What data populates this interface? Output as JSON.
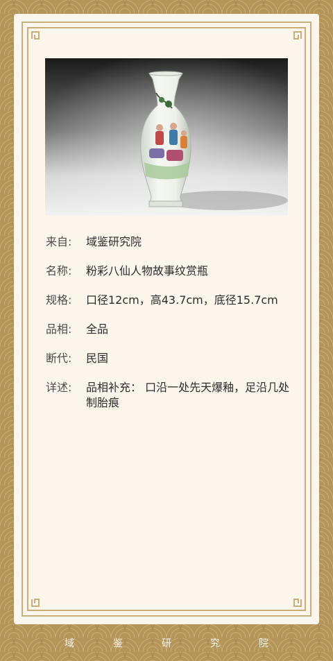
{
  "details": [
    {
      "label": "来自:",
      "value": "域鉴研究院"
    },
    {
      "label": "名称:",
      "value": "粉彩八仙人物故事纹赏瓶"
    },
    {
      "label": "规格:",
      "value": "口径12cm，高43.7cm，底径15.7cm"
    },
    {
      "label": "品相:",
      "value": "全品"
    },
    {
      "label": "断代:",
      "value": "民国"
    },
    {
      "label": "详述:",
      "value": "品相补充： 口沿一处先天爆釉，足沿几处制胎痕"
    }
  ],
  "footer": {
    "brand": "域鉴研究院"
  },
  "photo": {
    "icon": "porcelain-vase-photo"
  },
  "colors": {
    "background": "#b4955a",
    "card": "#fdf6ec",
    "frame": "#c9ad7a",
    "text": "#2b2b2b"
  }
}
